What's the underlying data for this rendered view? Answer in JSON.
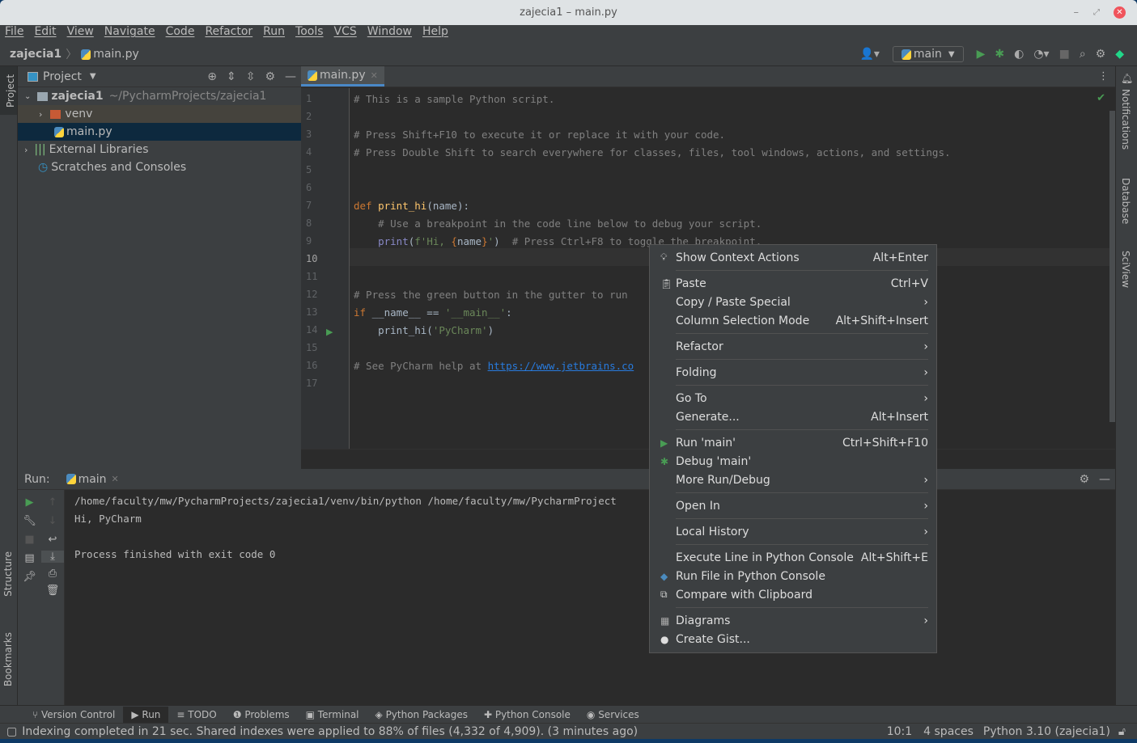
{
  "window": {
    "title": "zajecia1 – main.py"
  },
  "menu": [
    "File",
    "Edit",
    "View",
    "Navigate",
    "Code",
    "Refactor",
    "Run",
    "Tools",
    "VCS",
    "Window",
    "Help"
  ],
  "breadcrumb": {
    "project": "zajecia1",
    "file": "main.py"
  },
  "run_config": "main",
  "left_stripe": {
    "project": "Project",
    "structure": "Structure",
    "bookmarks": "Bookmarks"
  },
  "right_stripe": {
    "notifications": "Notifications",
    "database": "Database",
    "sciview": "SciView"
  },
  "project_panel": {
    "title": "Project",
    "tree": [
      {
        "label": "zajecia1",
        "path": "~/PycharmProjects/zajecia1"
      },
      {
        "label": "venv"
      },
      {
        "label": "main.py"
      },
      {
        "label": "External Libraries"
      },
      {
        "label": "Scratches and Consoles"
      }
    ]
  },
  "editor": {
    "tab": "main.py",
    "current_line": "10",
    "lines": [
      [
        [
          "cm",
          "# This is a sample Python script."
        ]
      ],
      [],
      [
        [
          "cm",
          "# Press Shift+F10 to execute it or replace it with your code."
        ]
      ],
      [
        [
          "cm",
          "# Press Double Shift to search everywhere for classes, files, tool windows, actions, and settings."
        ]
      ],
      [],
      [],
      [
        [
          "kw",
          "def "
        ],
        [
          "fn",
          "print_hi"
        ],
        [
          "",
          "(name):"
        ]
      ],
      [
        [
          "cm",
          "    # Use a breakpoint in the code line below to debug your script."
        ]
      ],
      [
        [
          "bi",
          "    print"
        ],
        [
          "",
          "("
        ],
        [
          "st",
          "f'Hi, "
        ],
        [
          "kw",
          "{"
        ],
        [
          "",
          "name"
        ],
        [
          "kw",
          "}"
        ],
        [
          "st",
          "'"
        ],
        [
          "",
          ")  "
        ],
        [
          "cm",
          "# Press Ctrl+F8 to toggle the breakpoint."
        ]
      ],
      [],
      [],
      [
        [
          "cm",
          "# Press the green button in the gutter to run"
        ]
      ],
      [
        [
          "kw",
          "if "
        ],
        [
          "",
          "__name__ == "
        ],
        [
          "st",
          "'__main__'"
        ],
        [
          "",
          ":"
        ]
      ],
      [
        [
          "",
          "    print_hi("
        ],
        [
          "st",
          "'PyCharm'"
        ],
        [
          "",
          ")"
        ]
      ],
      [],
      [
        [
          "cm",
          "# See PyCharm help at "
        ],
        [
          "lk",
          "https://www.jetbrains.co"
        ]
      ],
      []
    ]
  },
  "run": {
    "label": "Run:",
    "tab": "main",
    "output": [
      "/home/faculty/mw/PycharmProjects/zajecia1/venv/bin/python /home/faculty/mw/PycharmProject",
      "Hi, PyCharm",
      "",
      "Process finished with exit code 0"
    ]
  },
  "context_menu": [
    {
      "label": "Show Context Actions",
      "shortcut": "Alt+Enter",
      "icon": "bulb-icon"
    },
    {
      "sep": true
    },
    {
      "label": "Paste",
      "shortcut": "Ctrl+V",
      "icon": "clipboard-icon"
    },
    {
      "label": "Copy / Paste Special",
      "submenu": true
    },
    {
      "label": "Column Selection Mode",
      "shortcut": "Alt+Shift+Insert"
    },
    {
      "sep": true
    },
    {
      "label": "Refactor",
      "submenu": true
    },
    {
      "sep": true
    },
    {
      "label": "Folding",
      "submenu": true
    },
    {
      "sep": true
    },
    {
      "label": "Go To",
      "submenu": true
    },
    {
      "label": "Generate...",
      "shortcut": "Alt+Insert"
    },
    {
      "sep": true
    },
    {
      "label": "Run 'main'",
      "shortcut": "Ctrl+Shift+F10",
      "icon": "run-icon"
    },
    {
      "label": "Debug 'main'",
      "icon": "debug-icon"
    },
    {
      "label": "More Run/Debug",
      "submenu": true
    },
    {
      "sep": true
    },
    {
      "label": "Open In",
      "submenu": true
    },
    {
      "sep": true
    },
    {
      "label": "Local History",
      "submenu": true
    },
    {
      "sep": true
    },
    {
      "label": "Execute Line in Python Console",
      "shortcut": "Alt+Shift+E"
    },
    {
      "label": "Run File in Python Console",
      "icon": "python-icon"
    },
    {
      "label": "Compare with Clipboard",
      "icon": "compare-icon"
    },
    {
      "sep": true
    },
    {
      "label": "Diagrams",
      "submenu": true,
      "icon": "diagram-icon"
    },
    {
      "label": "Create Gist...",
      "icon": "github-icon"
    }
  ],
  "tool_windows": [
    "Version Control",
    "Run",
    "TODO",
    "Problems",
    "Terminal",
    "Python Packages",
    "Python Console",
    "Services"
  ],
  "status": {
    "message": "Indexing completed in 21 sec. Shared indexes were applied to 88% of files (4,332 of 4,909). (3 minutes ago)",
    "position": "10:1",
    "indent": "4 spaces",
    "interpreter": "Python 3.10 (zajecia1)"
  }
}
